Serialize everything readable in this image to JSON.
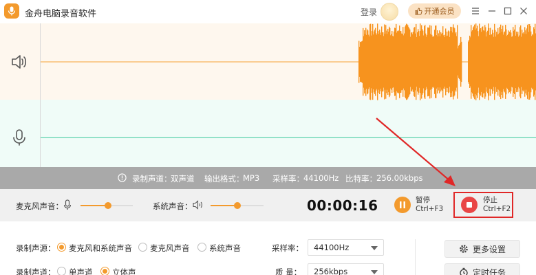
{
  "titlebar": {
    "app_title": "金舟电脑录音软件",
    "login_label": "登录",
    "vip_label": "开通会员",
    "menu_icon": "menu-icon",
    "minimize_icon": "minimize-icon",
    "maximize_icon": "maximize-icon",
    "close_icon": "close-icon"
  },
  "colors": {
    "accent": "#f39a2d",
    "speaker_wave": "#f7931e",
    "mic_wave": "#72d8b8",
    "stop": "#e94646",
    "annotation": "#e02727"
  },
  "tracks": {
    "speaker_icon": "speaker-icon",
    "mic_icon": "microphone-icon"
  },
  "status": {
    "channel_label": "录制声道：",
    "channel_value": "双声道",
    "format_label": "输出格式：",
    "format_value": "MP3",
    "rate_label": "采样率：",
    "rate_value": "44100Hz",
    "bitrate_label": "比特率：",
    "bitrate_value": "256.00kbps"
  },
  "controls": {
    "mic_volume_label": "麦克风声音：",
    "mic_volume_level": 0.52,
    "system_volume_label": "系统声音：",
    "system_volume_level": 0.5,
    "timer": "00:00:16",
    "pause_label": "暂停",
    "pause_shortcut": "Ctrl+F3",
    "stop_label": "停止",
    "stop_shortcut": "Ctrl+F2"
  },
  "settings": {
    "source_label": "录制声源：",
    "source_options": [
      "麦克风和系统声音",
      "麦克风声音",
      "系统声音"
    ],
    "source_selected": "麦克风和系统声音",
    "channel_label": "录制声道：",
    "channel_options": [
      "单声道",
      "立体声"
    ],
    "channel_selected": "立体声",
    "sample_rate_label": "采样率：",
    "sample_rate_value": "44100Hz",
    "quality_label": "质 量：",
    "quality_value": "256kbps",
    "more_settings_label": "更多设置",
    "scheduled_task_label": "定时任务"
  }
}
